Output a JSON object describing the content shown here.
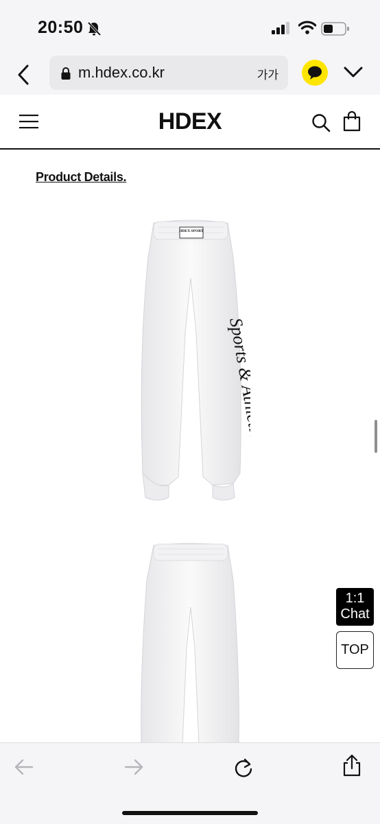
{
  "status_bar": {
    "time": "20:50",
    "icons": [
      "bell-slash-icon",
      "signal-icon",
      "wifi-icon",
      "battery-icon"
    ]
  },
  "browser": {
    "url": "m.hdex.co.kr",
    "text_size_label": "가가",
    "icons": [
      "back-chevron-icon",
      "lock-icon",
      "kakao-icon",
      "chevron-down-icon"
    ]
  },
  "header": {
    "logo": "HDEX",
    "icons": [
      "hamburger-menu-icon",
      "search-icon",
      "shopping-bag-icon"
    ]
  },
  "content": {
    "section_title": "Product Details.",
    "product_images": [
      "white sweatpants front view",
      "white sweatpants back view"
    ],
    "waistband_label": "HDEX SPORT",
    "leg_print": "Sports & Athletic"
  },
  "floating_buttons": {
    "chat_line1": "1:1",
    "chat_line2": "Chat",
    "top_label": "TOP"
  },
  "toolbar": {
    "icons": [
      "arrow-left-icon",
      "arrow-right-icon",
      "reload-icon",
      "share-icon"
    ]
  },
  "colors": {
    "kakao_yellow": "#fee500",
    "chat_bg": "#000000",
    "browser_chrome": "#f5f5f7"
  }
}
